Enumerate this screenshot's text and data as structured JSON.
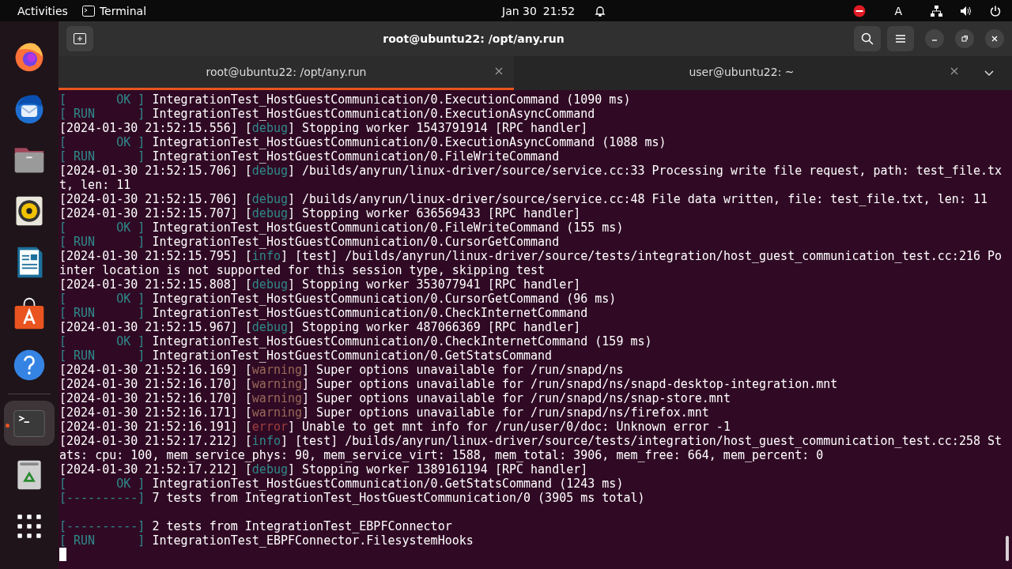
{
  "top_bar": {
    "activities": "Activities",
    "app_name": "Terminal",
    "date": "Jan 30",
    "time": "21:52",
    "keyboard_layout": "A"
  },
  "dock": {
    "items": [
      {
        "kind": "firefox",
        "running": false
      },
      {
        "kind": "thunderbird",
        "running": false
      },
      {
        "kind": "files",
        "running": false
      },
      {
        "kind": "rhythmbox",
        "running": false
      },
      {
        "kind": "writer",
        "running": false
      },
      {
        "kind": "appcenter",
        "running": false
      },
      {
        "kind": "help",
        "running": false
      },
      {
        "kind": "separator"
      },
      {
        "kind": "terminal",
        "running": true
      },
      {
        "kind": "trash",
        "running": false
      },
      {
        "kind": "apps",
        "running": false
      }
    ]
  },
  "window": {
    "title": "root@ubuntu22: /opt/any.run"
  },
  "tabs": [
    {
      "label": "root@ubuntu22: /opt/any.run",
      "selected": true
    },
    {
      "label": "user@ubuntu22: ~",
      "selected": false
    }
  ],
  "terminal": {
    "lines": [
      {
        "kind": "text",
        "segments": [
          {
            "text": "[       OK ]",
            "kind": "tag"
          },
          {
            "text": " IntegrationTest_HostGuestCommunication/0.ExecutionCommand (1090 ms)",
            "kind": "plain"
          }
        ]
      },
      {
        "kind": "text",
        "segments": [
          {
            "text": "[ RUN      ]",
            "kind": "tag"
          },
          {
            "text": " IntegrationTest_HostGuestCommunication/0.ExecutionAsyncCommand",
            "kind": "plain"
          }
        ]
      },
      {
        "kind": "text",
        "segments": [
          {
            "text": "[2024-01-30 21:52:15.556] [",
            "kind": "plain"
          },
          {
            "text": "debug",
            "kind": "tag"
          },
          {
            "text": "] Stopping worker 1543791914 [RPC handler]",
            "kind": "plain"
          }
        ]
      },
      {
        "kind": "text",
        "segments": [
          {
            "text": "[       OK ]",
            "kind": "tag"
          },
          {
            "text": " IntegrationTest_HostGuestCommunication/0.ExecutionAsyncCommand (1088 ms)",
            "kind": "plain"
          }
        ]
      },
      {
        "kind": "text",
        "segments": [
          {
            "text": "[ RUN      ]",
            "kind": "tag"
          },
          {
            "text": " IntegrationTest_HostGuestCommunication/0.FileWriteCommand",
            "kind": "plain"
          }
        ]
      },
      {
        "kind": "text",
        "segments": [
          {
            "text": "[2024-01-30 21:52:15.706] [",
            "kind": "plain"
          },
          {
            "text": "debug",
            "kind": "tag"
          },
          {
            "text": "] /builds/anyrun/linux-driver/source/service.cc:33 Processing write file request, path: test_file.tx",
            "kind": "plain"
          }
        ]
      },
      {
        "kind": "text",
        "segments": [
          {
            "text": "t, len: 11",
            "kind": "plain"
          }
        ]
      },
      {
        "kind": "text",
        "segments": [
          {
            "text": "[2024-01-30 21:52:15.706] [",
            "kind": "plain"
          },
          {
            "text": "debug",
            "kind": "tag"
          },
          {
            "text": "] /builds/anyrun/linux-driver/source/service.cc:48 File data written, file: test_file.txt, len: 11",
            "kind": "plain"
          }
        ]
      },
      {
        "kind": "text",
        "segments": [
          {
            "text": "[2024-01-30 21:52:15.707] [",
            "kind": "plain"
          },
          {
            "text": "debug",
            "kind": "tag"
          },
          {
            "text": "] Stopping worker 636569433 [RPC handler]",
            "kind": "plain"
          }
        ]
      },
      {
        "kind": "text",
        "segments": [
          {
            "text": "[       OK ]",
            "kind": "tag"
          },
          {
            "text": " IntegrationTest_HostGuestCommunication/0.FileWriteCommand (155 ms)",
            "kind": "plain"
          }
        ]
      },
      {
        "kind": "text",
        "segments": [
          {
            "text": "[ RUN      ]",
            "kind": "tag"
          },
          {
            "text": " IntegrationTest_HostGuestCommunication/0.CursorGetCommand",
            "kind": "plain"
          }
        ]
      },
      {
        "kind": "text",
        "segments": [
          {
            "text": "[2024-01-30 21:52:15.795] [",
            "kind": "plain"
          },
          {
            "text": "info",
            "kind": "tag"
          },
          {
            "text": "] [test] /builds/anyrun/linux-driver/source/tests/integration/host_guest_communication_test.cc:216 Po",
            "kind": "plain"
          }
        ]
      },
      {
        "kind": "text",
        "segments": [
          {
            "text": "inter location is not supported for this session type, skipping test",
            "kind": "plain"
          }
        ]
      },
      {
        "kind": "text",
        "segments": [
          {
            "text": "[2024-01-30 21:52:15.808] [",
            "kind": "plain"
          },
          {
            "text": "debug",
            "kind": "tag"
          },
          {
            "text": "] Stopping worker 353077941 [RPC handler]",
            "kind": "plain"
          }
        ]
      },
      {
        "kind": "text",
        "segments": [
          {
            "text": "[       OK ]",
            "kind": "tag"
          },
          {
            "text": " IntegrationTest_HostGuestCommunication/0.CursorGetCommand (96 ms)",
            "kind": "plain"
          }
        ]
      },
      {
        "kind": "text",
        "segments": [
          {
            "text": "[ RUN      ]",
            "kind": "tag"
          },
          {
            "text": " IntegrationTest_HostGuestCommunication/0.CheckInternetCommand",
            "kind": "plain"
          }
        ]
      },
      {
        "kind": "text",
        "segments": [
          {
            "text": "[2024-01-30 21:52:15.967] [",
            "kind": "plain"
          },
          {
            "text": "debug",
            "kind": "tag"
          },
          {
            "text": "] Stopping worker 487066369 [RPC handler]",
            "kind": "plain"
          }
        ]
      },
      {
        "kind": "text",
        "segments": [
          {
            "text": "[       OK ]",
            "kind": "tag"
          },
          {
            "text": " IntegrationTest_HostGuestCommunication/0.CheckInternetCommand (159 ms)",
            "kind": "plain"
          }
        ]
      },
      {
        "kind": "text",
        "segments": [
          {
            "text": "[ RUN      ]",
            "kind": "tag"
          },
          {
            "text": " IntegrationTest_HostGuestCommunication/0.GetStatsCommand",
            "kind": "plain"
          }
        ]
      },
      {
        "kind": "text",
        "segments": [
          {
            "text": "[2024-01-30 21:52:16.169] [",
            "kind": "plain"
          },
          {
            "text": "warning",
            "kind": "warning"
          },
          {
            "text": "] Super options unavailable for /run/snapd/ns",
            "kind": "plain"
          }
        ]
      },
      {
        "kind": "text",
        "segments": [
          {
            "text": "[2024-01-30 21:52:16.170] [",
            "kind": "plain"
          },
          {
            "text": "warning",
            "kind": "warning"
          },
          {
            "text": "] Super options unavailable for /run/snapd/ns/snapd-desktop-integration.mnt",
            "kind": "plain"
          }
        ]
      },
      {
        "kind": "text",
        "segments": [
          {
            "text": "[2024-01-30 21:52:16.170] [",
            "kind": "plain"
          },
          {
            "text": "warning",
            "kind": "warning"
          },
          {
            "text": "] Super options unavailable for /run/snapd/ns/snap-store.mnt",
            "kind": "plain"
          }
        ]
      },
      {
        "kind": "text",
        "segments": [
          {
            "text": "[2024-01-30 21:52:16.171] [",
            "kind": "plain"
          },
          {
            "text": "warning",
            "kind": "warning"
          },
          {
            "text": "] Super options unavailable for /run/snapd/ns/firefox.mnt",
            "kind": "plain"
          }
        ]
      },
      {
        "kind": "text",
        "segments": [
          {
            "text": "[2024-01-30 21:52:16.191] [",
            "kind": "plain"
          },
          {
            "text": "error",
            "kind": "error"
          },
          {
            "text": "] Unable to get mnt info for /run/user/0/doc: Unknown error -1",
            "kind": "plain"
          }
        ]
      },
      {
        "kind": "text",
        "segments": [
          {
            "text": "[2024-01-30 21:52:17.212] [",
            "kind": "plain"
          },
          {
            "text": "info",
            "kind": "tag"
          },
          {
            "text": "] [test] /builds/anyrun/linux-driver/source/tests/integration/host_guest_communication_test.cc:258 St",
            "kind": "plain"
          }
        ]
      },
      {
        "kind": "text",
        "segments": [
          {
            "text": "ats: cpu: 100, mem_service_phys: 90, mem_service_virt: 1588, mem_total: 3906, mem_free: 664, mem_percent: 0",
            "kind": "plain"
          }
        ]
      },
      {
        "kind": "text",
        "segments": [
          {
            "text": "[2024-01-30 21:52:17.212] [",
            "kind": "plain"
          },
          {
            "text": "debug",
            "kind": "tag"
          },
          {
            "text": "] Stopping worker 1389161194 [RPC handler]",
            "kind": "plain"
          }
        ]
      },
      {
        "kind": "text",
        "segments": [
          {
            "text": "[       OK ]",
            "kind": "tag"
          },
          {
            "text": " IntegrationTest_HostGuestCommunication/0.GetStatsCommand (1243 ms)",
            "kind": "plain"
          }
        ]
      },
      {
        "kind": "text",
        "segments": [
          {
            "text": "[----------]",
            "kind": "tag"
          },
          {
            "text": " 7 tests from IntegrationTest_HostGuestCommunication/0 (3905 ms total)",
            "kind": "plain"
          }
        ]
      },
      {
        "kind": "blank"
      },
      {
        "kind": "text",
        "segments": [
          {
            "text": "[----------]",
            "kind": "tag"
          },
          {
            "text": " 2 tests from IntegrationTest_EBPFConnector",
            "kind": "plain"
          }
        ]
      },
      {
        "kind": "text",
        "segments": [
          {
            "text": "[ RUN      ]",
            "kind": "tag"
          },
          {
            "text": " IntegrationTest_EBPFConnector.FilesystemHooks",
            "kind": "plain"
          }
        ]
      },
      {
        "kind": "cursor"
      }
    ]
  }
}
